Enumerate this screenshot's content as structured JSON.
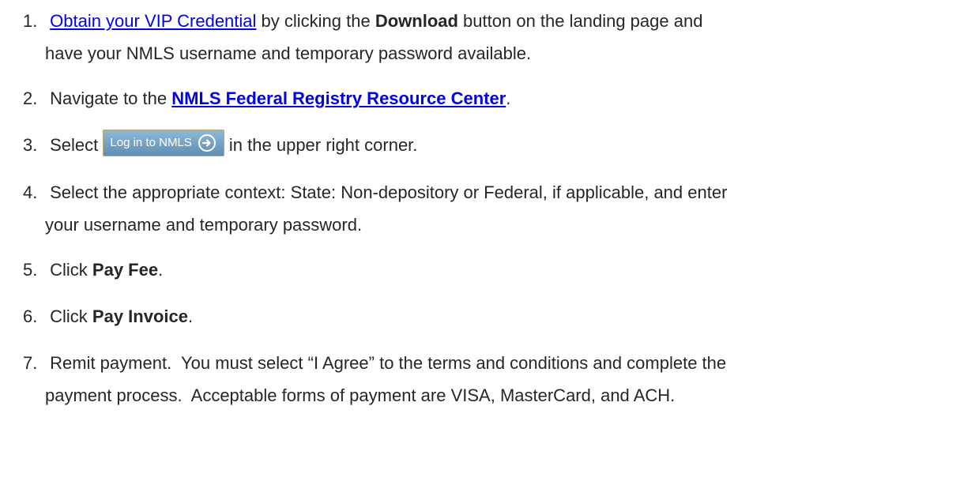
{
  "steps": [
    {
      "number": "1.",
      "line1_link": "Obtain your VIP Credential",
      "line1_mid": " by clicking the ",
      "line1_bold": "Download",
      "line1_end": " button on the landing page and",
      "line2": "have your NMLS username and temporary password available."
    },
    {
      "number": "2.",
      "pre": "Navigate to the ",
      "link": "NMLS Federal Registry Resource Center",
      "post": "."
    },
    {
      "number": "3.",
      "pre": "Select",
      "button_label": "Log in to NMLS",
      "post": "in the upper right corner."
    },
    {
      "number": "4.",
      "line1": "Select the appropriate context: State: Non-depository or Federal, if applicable, and enter",
      "line2": "your username and temporary password."
    },
    {
      "number": "5.",
      "pre": "Click ",
      "bold": "Pay Fee",
      "post": "."
    },
    {
      "number": "6.",
      "pre": "Click ",
      "bold": "Pay Invoice",
      "post": "."
    },
    {
      "number": "7.",
      "line1": "Remit payment.  You must select “I Agree” to the terms and conditions and complete the",
      "line2": "payment process.  Acceptable forms of payment are VISA, MasterCard, and ACH."
    }
  ],
  "colors": {
    "link": "#0000ee",
    "text": "#262626",
    "button": "#6f9cc0"
  },
  "icons": {
    "login_button_icon": "arrow-right-circle-icon"
  }
}
